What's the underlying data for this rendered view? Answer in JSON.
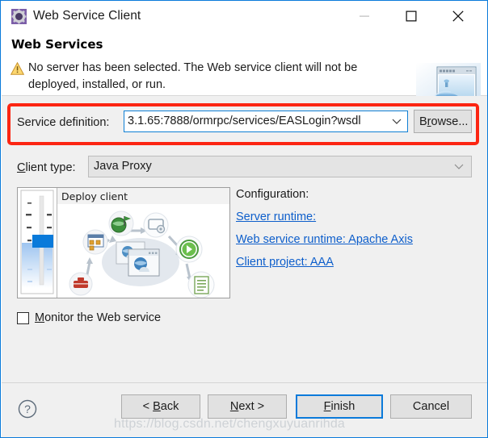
{
  "window": {
    "title": "Web Service Client",
    "icon": "gear-icon",
    "controls": {
      "minimize": "minimize-icon",
      "maximize": "maximize-icon",
      "close": "close-icon"
    }
  },
  "header": {
    "title": "Web Services",
    "warning_icon": "warning-triangle-icon",
    "message": "No server has been selected. The Web service client will not be deployed, installed, or run.",
    "banner_icon": "web-service-server-icon"
  },
  "form": {
    "service_definition": {
      "label": "Service definition:",
      "value": "3.1.65:7888/ormrpc/services/EASLogin?wsdl",
      "placeholder": "",
      "dropdown_icon": "chevron-down-icon",
      "browse_label": "Browse..."
    },
    "client_type": {
      "label": "Client type:",
      "value": "Java Proxy",
      "dropdown_icon": "chevron-down-icon",
      "options": [
        "Java Proxy"
      ]
    }
  },
  "preview": {
    "diagram_title": "Deploy client",
    "stage_widget": "deployment-stage-slider"
  },
  "configuration": {
    "title": "Configuration:",
    "links": [
      "Server runtime: ",
      "Web service runtime: Apache Axis",
      "Client project: AAA"
    ]
  },
  "monitor": {
    "label": "Monitor the Web service",
    "checked": false
  },
  "footer": {
    "help_icon": "help-question-icon",
    "buttons": [
      "< Back",
      "Next >",
      "Finish",
      "Cancel"
    ]
  },
  "watermark": "https://blog.csdn.net/chengxuyuanrihda",
  "colors": {
    "accent": "#0a7ada",
    "highlight_box": "#fc2512",
    "link": "#0d5ecb",
    "dialog_bg": "#f0f0f0",
    "warning": "#f0ad20"
  }
}
